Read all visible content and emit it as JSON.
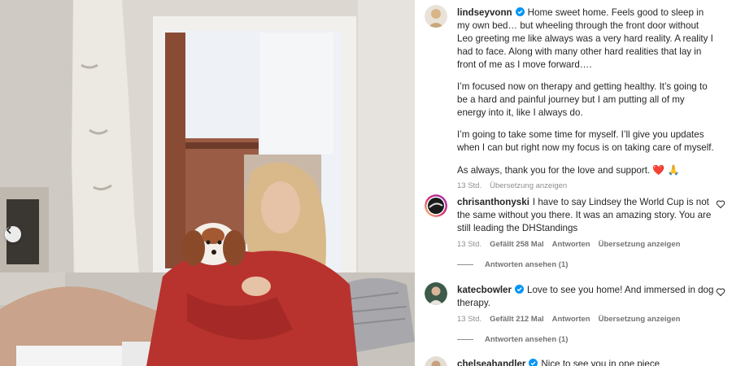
{
  "caption": {
    "username": "lindseyvonn",
    "paragraphs": [
      "Home sweet home. Feels good to sleep in my own bed… but wheeling through the front door without Leo greeting me like always was a very hard reality. A reality I had to face. Along with many other hard realities that lay in front of me as I move forward….",
      "I’m focused now on therapy and getting healthy. It’s going to be a hard and painful journey but I am putting all of my energy into it, like I always do.",
      "I’m going to take some time for myself. I’ll give you updates when I can but right now my focus is on taking care of myself.",
      "As always, thank you for the love and support."
    ],
    "emoji": "❤️ 🙏",
    "time": "13 Std.",
    "translate": "Übersetzung anzeigen"
  },
  "comments": [
    {
      "username": "chrisanthonyski",
      "text": "I have to say Lindsey the World Cup is not the same without you there. It was an amazing story. You are still leading the DHStandings",
      "time": "13 Std.",
      "likes": "Gefällt 258 Mal",
      "reply": "Antworten",
      "translate": "Übersetzung anzeigen",
      "view_replies": "Antworten ansehen (1)"
    },
    {
      "username": "katecbowler",
      "text": "Love to see you home! And immersed in dog therapy.",
      "time": "13 Std.",
      "likes": "Gefällt 212 Mal",
      "reply": "Antworten",
      "translate": "Übersetzung anzeigen",
      "view_replies": "Antworten ansehen (1)"
    },
    {
      "username": "chelseahandler",
      "text": "Nice to see you in one piece"
    }
  ],
  "colors": {
    "verified": "#0095f6",
    "muted": "#8e8e8e",
    "text": "#262626"
  },
  "icons": {
    "verified": "verified-badge-icon",
    "heart": "heart-outline-icon",
    "prev": "chevron-left-icon"
  }
}
